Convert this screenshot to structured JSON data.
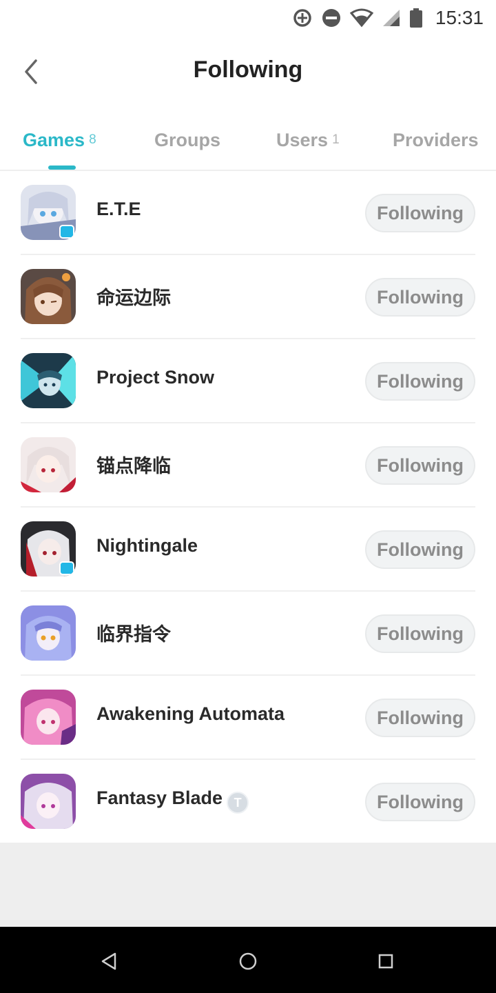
{
  "status_bar": {
    "time": "15:31",
    "icons": [
      "data-saver-icon",
      "do-not-disturb-icon",
      "wifi-icon",
      "signal-icon",
      "battery-icon"
    ]
  },
  "header": {
    "title": "Following",
    "back_icon": "chevron-left-icon"
  },
  "tabs": [
    {
      "label": "Games",
      "count": "8",
      "active": true
    },
    {
      "label": "Groups",
      "count": "",
      "active": false
    },
    {
      "label": "Users",
      "count": "1",
      "active": false
    },
    {
      "label": "Providers",
      "count": "",
      "active": false
    }
  ],
  "games": [
    {
      "name": "E.T.E",
      "button": "Following",
      "tv_badge": true
    },
    {
      "name": "命运边际",
      "button": "Following"
    },
    {
      "name": "Project Snow",
      "button": "Following"
    },
    {
      "name": "锚点降临",
      "button": "Following"
    },
    {
      "name": "Nightingale",
      "button": "Following",
      "tv_badge": true
    },
    {
      "name": "临界指令",
      "button": "Following"
    },
    {
      "name": "Awakening Automata",
      "button": "Following"
    },
    {
      "name": "Fantasy Blade",
      "button": "Following",
      "badge": "T"
    }
  ],
  "nav": {
    "back_icon": "nav-back-icon",
    "home_icon": "nav-home-icon",
    "recents_icon": "nav-recents-icon"
  },
  "colors": {
    "accent": "#2bb8c8",
    "inactive_tab": "#a6a6a6",
    "button_bg": "#f1f3f4",
    "button_text": "#8c8c8c"
  }
}
